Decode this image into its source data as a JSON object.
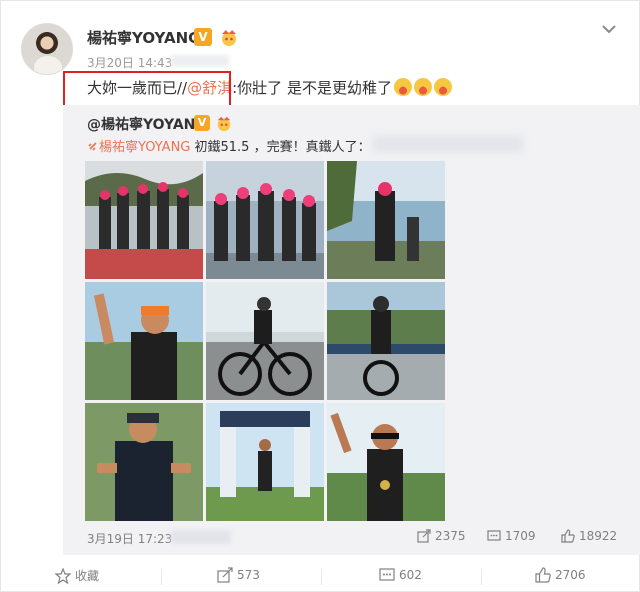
{
  "author": {
    "name": "楊祐寧YOYANG",
    "verified_mark": "V"
  },
  "post": {
    "date": "3月20日 14:43",
    "text_prefix": "大妳一歲而已//",
    "mention": "@舒淇",
    "text_suffix": ":你壯了 是不是更幼稚了"
  },
  "repost": {
    "author_name": "@楊祐寧YOYANG",
    "verified_mark": "V",
    "link_text": "楊祐寧YOYANG",
    "text": " 初鐵51.5 ，完賽！真鐵人了：",
    "images": [
      {
        "scene": "photo-group-pink-caps-1"
      },
      {
        "scene": "photo-group-pink-caps-2"
      },
      {
        "scene": "photo-lake-standing"
      },
      {
        "scene": "photo-waving-orange-cap"
      },
      {
        "scene": "photo-cycling-road"
      },
      {
        "scene": "photo-cycling-bridge"
      },
      {
        "scene": "photo-gym-shirt"
      },
      {
        "scene": "photo-finish-line"
      },
      {
        "scene": "photo-peace-sign"
      }
    ],
    "date": "3月19日 17:23",
    "reposts": "2375",
    "comments": "1709",
    "likes": "18922"
  },
  "actions": {
    "favorite": "收藏",
    "repost": "573",
    "comment": "602",
    "like": "2706"
  },
  "colors": {
    "accent": "#eb7350",
    "highlight_box": "#e02020",
    "verified": "#f6a623"
  }
}
